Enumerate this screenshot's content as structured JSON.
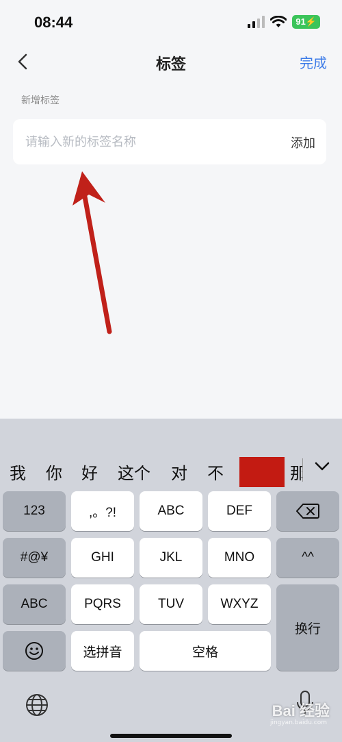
{
  "status_bar": {
    "time": "08:44",
    "battery": "91"
  },
  "nav": {
    "title": "标签",
    "done_label": "完成"
  },
  "section": {
    "label": "新增标签"
  },
  "tag_input": {
    "placeholder": "请输入新的标签名称",
    "value": "",
    "add_label": "添加"
  },
  "keyboard": {
    "candidates": [
      "我",
      "你",
      "好",
      "这个",
      "对",
      "不",
      "那"
    ],
    "keys": {
      "num": "123",
      "punct": ",。?!",
      "abc": "ABC",
      "def": "DEF",
      "sym": "#@¥",
      "ghi": "GHI",
      "jkl": "JKL",
      "mno": "MNO",
      "emoticon": "^^",
      "abc_switch": "ABC",
      "pqrs": "PQRS",
      "tuv": "TUV",
      "wxyz": "WXYZ",
      "return": "换行",
      "pinyin": "选拼音",
      "space": "空格"
    }
  },
  "watermark": {
    "text": "Bai 经验",
    "sub": "jingyan.baidu.com"
  },
  "colors": {
    "accent": "#3c7be8",
    "arrow": "#c0211a",
    "redaction": "#c31b12"
  }
}
